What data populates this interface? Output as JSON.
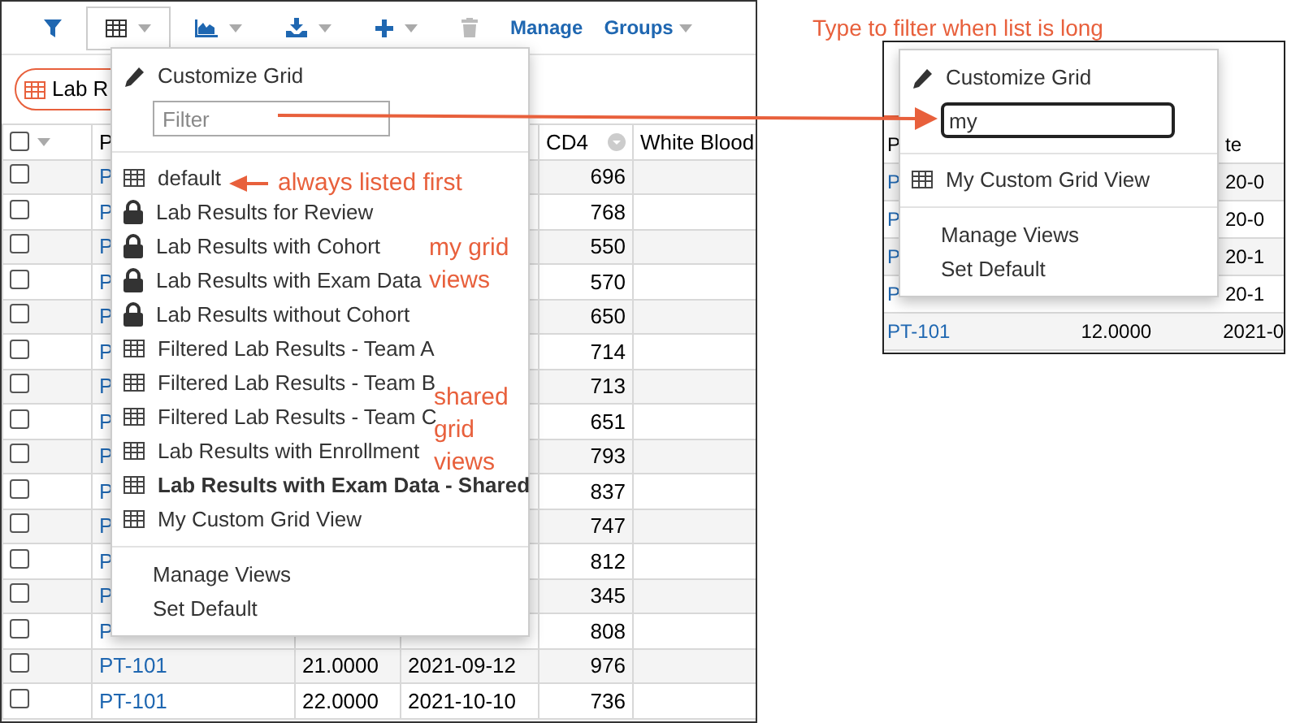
{
  "toolbar": {
    "buttons": [
      {
        "kind": "filter",
        "has_menu": false,
        "expanded": false
      },
      {
        "kind": "grid",
        "has_menu": true,
        "expanded": true
      },
      {
        "kind": "chart",
        "has_menu": true,
        "expanded": false
      },
      {
        "kind": "export",
        "has_menu": true,
        "expanded": false
      },
      {
        "kind": "insert",
        "has_menu": true,
        "expanded": false
      },
      {
        "kind": "delete",
        "has_menu": false,
        "expanded": false
      }
    ],
    "links": [
      {
        "label": "Manage",
        "has_menu": false
      },
      {
        "label": "Groups",
        "has_menu": true
      }
    ]
  },
  "view_tab": {
    "label": "Lab R"
  },
  "grid": {
    "header": {
      "select_all": {
        "checked": false
      },
      "participant": "P",
      "cd4": "CD4",
      "column_6": "White Blood"
    },
    "rows": [
      {
        "checked": false,
        "participant": "P",
        "cd4": "696"
      },
      {
        "checked": false,
        "participant": "P",
        "cd4": "768"
      },
      {
        "checked": false,
        "participant": "P",
        "cd4": "550"
      },
      {
        "checked": false,
        "participant": "P",
        "cd4": "570"
      },
      {
        "checked": false,
        "participant": "P",
        "cd4": "650"
      },
      {
        "checked": false,
        "participant": "P",
        "cd4": "714"
      },
      {
        "checked": false,
        "participant": "P",
        "cd4": "713"
      },
      {
        "checked": false,
        "participant": "P",
        "cd4": "651"
      },
      {
        "checked": false,
        "participant": "P",
        "cd4": "793"
      },
      {
        "checked": false,
        "participant": "P",
        "cd4": "837"
      },
      {
        "checked": false,
        "participant": "P",
        "cd4": "747"
      },
      {
        "checked": false,
        "participant": "P",
        "cd4": "812"
      },
      {
        "checked": false,
        "participant": "P",
        "cd4": "345"
      },
      {
        "checked": false,
        "participant": "P",
        "cd4": "808"
      },
      {
        "checked": false,
        "participant": "PT-101",
        "column_3": "21.0000",
        "column_4": "2021-09-12",
        "cd4": "976"
      },
      {
        "checked": false,
        "participant": "PT-101",
        "column_3": "22.0000",
        "column_4": "2021-10-10",
        "cd4": "736"
      }
    ]
  },
  "views_menu": {
    "customize": "Customize Grid",
    "filter_placeholder": "Filter",
    "views": [
      {
        "kind": "grid",
        "label": "default",
        "selected": false
      },
      {
        "kind": "lock",
        "label": "Lab Results for Review",
        "selected": false
      },
      {
        "kind": "lock",
        "label": "Lab Results with Cohort",
        "selected": false
      },
      {
        "kind": "lock",
        "label": "Lab Results with Exam Data",
        "selected": false
      },
      {
        "kind": "lock",
        "label": "Lab Results without Cohort",
        "selected": false
      },
      {
        "kind": "grid",
        "label": "Filtered Lab Results - Team A",
        "selected": false
      },
      {
        "kind": "grid",
        "label": "Filtered Lab Results - Team B",
        "selected": false
      },
      {
        "kind": "grid",
        "label": "Filtered Lab Results - Team C",
        "selected": false
      },
      {
        "kind": "grid",
        "label": "Lab Results with Enrollment",
        "selected": false
      },
      {
        "kind": "grid",
        "label": "Lab Results with Exam Data - Shared",
        "selected": true
      },
      {
        "kind": "grid",
        "label": "My Custom Grid View",
        "selected": false
      }
    ],
    "actions": [
      "Manage Views",
      "Set Default"
    ]
  },
  "filtered_example": {
    "header": {
      "participant": "P",
      "column_3": "te"
    },
    "rows": [
      {
        "participant": "P",
        "column_3": "20-0"
      },
      {
        "participant": "P",
        "column_3": "20-0"
      },
      {
        "participant": "P",
        "column_3": "20-1"
      },
      {
        "participant": "P",
        "column_3": "20-1"
      },
      {
        "participant": "PT-101",
        "column_2": "12.0000",
        "column_3": "2021-0"
      }
    ],
    "menu": {
      "customize": "Customize Grid",
      "filter_value": "my",
      "views": [
        {
          "kind": "grid",
          "label": "My Custom Grid View",
          "selected": false
        }
      ],
      "actions": [
        "Manage Views",
        "Set Default"
      ]
    }
  },
  "annotations": {
    "filter_hint": "Type to filter when list is long",
    "first_note": "always listed first",
    "my_views_note": "my grid views",
    "shared_views_note": "shared grid views"
  }
}
